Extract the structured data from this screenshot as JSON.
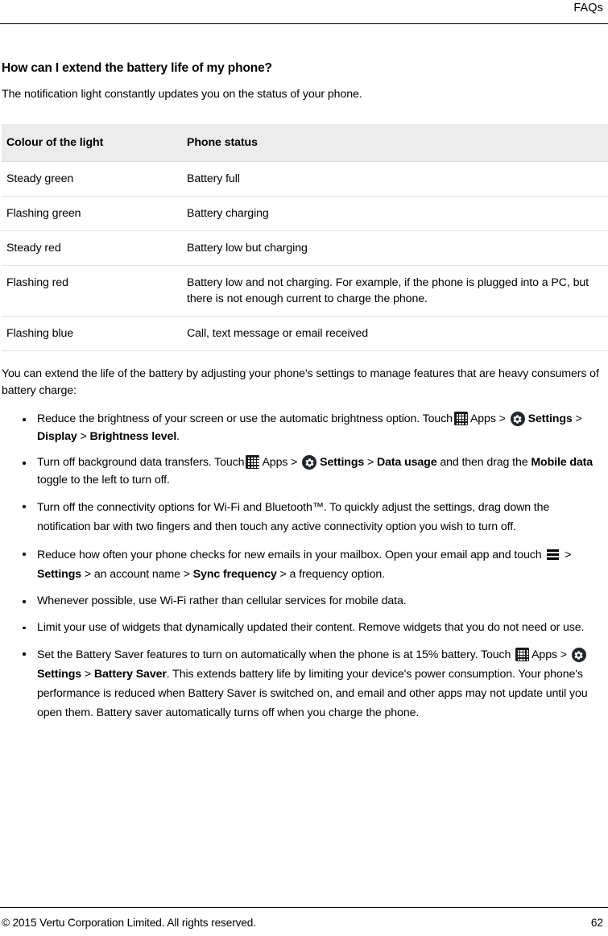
{
  "header": {
    "label": "FAQs"
  },
  "section": {
    "title": "How can I extend the battery life of my phone?",
    "intro": "The notification light constantly updates you on the status of your phone."
  },
  "table": {
    "columns": [
      "Colour of the light",
      "Phone status"
    ],
    "rows": [
      {
        "light": "Steady green",
        "status": "Battery full"
      },
      {
        "light": "Flashing green",
        "status": "Battery charging"
      },
      {
        "light": "Steady red",
        "status": "Battery low but charging"
      },
      {
        "light": "Flashing red",
        "status": "Battery low and not charging. For example, if the phone is plugged into a PC, but there is not enough current to charge the phone."
      },
      {
        "light": "Flashing blue",
        "status": "Call, text message or email received"
      }
    ]
  },
  "lead": "You can extend the life of the battery by adjusting your phone's settings to manage features that are heavy consumers of battery charge:",
  "tips": {
    "b1": {
      "t1": "Reduce the brightness of your screen or use the automatic brightness option. Touch",
      "apps": "Apps",
      "sep1": ">",
      "settings": "Settings",
      "sep2": ">",
      "display": "Display",
      "sep3": ">",
      "brightness": "Brightness level",
      "end": "."
    },
    "b2": {
      "t1": "Turn off background data transfers. Touch",
      "apps": "Apps",
      "sep1": ">",
      "settings": "Settings",
      "sep2": ">",
      "datausage": "Data usage",
      "t2": "and then drag the",
      "mobiledata": "Mobile data",
      "t3": "toggle to the left to turn off."
    },
    "b3": "Turn off the connectivity options for Wi-Fi and Bluetooth™. To quickly adjust the settings, drag down the notification bar with two fingers and then touch any active connectivity option you wish to turn off.",
    "b4": {
      "t1": "Reduce how often your phone checks for new emails in your mailbox. Open your email app and touch",
      "sep1": ">",
      "settings": "Settings",
      "sep2": ">",
      "account": "an account name",
      "sep3": ">",
      "syncfreq": "Sync frequency",
      "sep4": ">",
      "t2": "a frequency option."
    },
    "b5": "Whenever possible, use Wi-Fi rather than cellular services for mobile data.",
    "b6": "Limit your use of widgets that dynamically updated their content. Remove widgets that you do not need or use.",
    "b7": {
      "t1": "Set the Battery Saver features to turn on automatically when the phone is at 15% battery. Touch",
      "apps": "Apps",
      "sep1": ">",
      "settings": "Settings",
      "sep2": ">",
      "batterysaver": "Battery Saver",
      "t2": ". This extends battery life by limiting your device's power consumption. Your phone's performance is reduced when Battery Saver is switched on, and email and other apps may not update until you open them. Battery saver automatically turns off when you charge the phone."
    }
  },
  "footer": {
    "copyright": "© 2015 Vertu Corporation Limited. All rights reserved.",
    "page_number": "62"
  },
  "icons": {
    "apps": "apps-grid-icon",
    "settings": "gear-icon",
    "menu": "hamburger-menu-icon"
  },
  "colors": {
    "text": "#000000",
    "table_header_bg": "#ececec",
    "row_border": "#e2e2e2",
    "rule": "#000000",
    "icon_dark": "#1b1b1b"
  }
}
